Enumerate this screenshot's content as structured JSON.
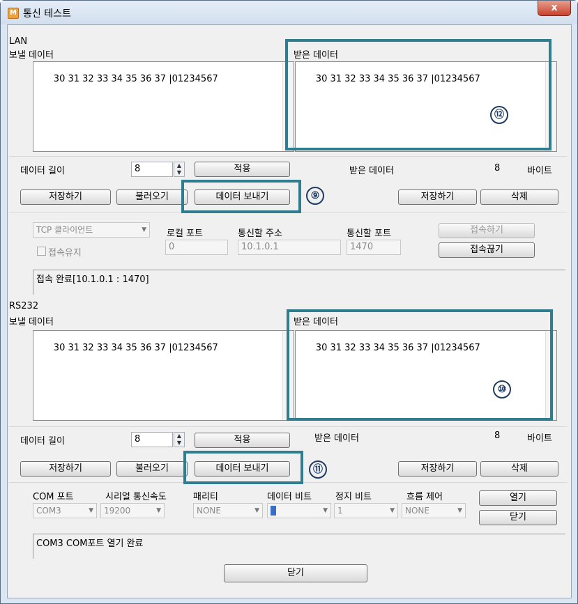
{
  "window": {
    "title": "통신 테스트",
    "app_icon": "M",
    "close_label": "x"
  },
  "lan": {
    "group_label": "LAN",
    "send_label": "보낼 데이터",
    "send_text": "30 31 32 33 34 35 36 37 |01234567",
    "recv_label": "받은 데이터",
    "recv_text": "30 31 32 33 34 35 36 37 |01234567",
    "data_length_label": "데이터 길이",
    "data_length_value": "8",
    "apply_button": "적용",
    "recv_data_label": "받은 데이터",
    "recv_count": "8",
    "bytes_label": "바이트",
    "save_button": "저장하기",
    "load_button": "불러오기",
    "send_button": "데이터 보내기",
    "recv_save_button": "저장하기",
    "delete_button": "삭제",
    "mode": "TCP 클라이언트",
    "keep_alive_label": "접속유지",
    "local_port_label": "로컬 포트",
    "local_port_value": "0",
    "comm_addr_label": "통신할 주소",
    "comm_addr_value": "10.1.0.1",
    "comm_port_label": "통신할 포트",
    "comm_port_value": "1470",
    "connect_button": "접속하기",
    "disconnect_button": "접속끊기",
    "status_text": "접속 완료[10.1.0.1 : 1470]"
  },
  "rs232": {
    "group_label": "RS232",
    "send_label": "보낼 데이터",
    "send_text": "30 31 32 33 34 35 36 37 |01234567",
    "recv_label": "받은 데이터",
    "recv_text": "30 31 32 33 34 35 36 37 |01234567",
    "data_length_label": "데이터 길이",
    "data_length_value": "8",
    "apply_button": "적용",
    "recv_data_label": "받은 데이터",
    "recv_count": "8",
    "bytes_label": "바이트",
    "save_button": "저장하기",
    "load_button": "불러오기",
    "send_button": "데이터 보내기",
    "recv_save_button": "저장하기",
    "delete_button": "삭제",
    "com_port_label": "COM 포트",
    "com_port_value": "COM3",
    "baud_label": "시리얼 통신속도",
    "baud_value": "19200",
    "parity_label": "패리티",
    "parity_value": "NONE",
    "data_bits_label": "데이터 비트",
    "data_bits_value": "8",
    "stop_bits_label": "정지 비트",
    "stop_bits_value": "1",
    "flow_label": "흐름 제어",
    "flow_value": "NONE",
    "open_button": "열기",
    "close_button": "닫기",
    "status_text": "COM3 COM포트 열기 완료"
  },
  "footer": {
    "close_button": "닫기"
  },
  "callouts": {
    "lan_send": "⑨",
    "rs232_recv": "⑩",
    "rs232_send": "⑪",
    "lan_recv": "⑫"
  },
  "colors": {
    "callout_border": "#2f7d8f",
    "badge": "#1f3b63"
  }
}
